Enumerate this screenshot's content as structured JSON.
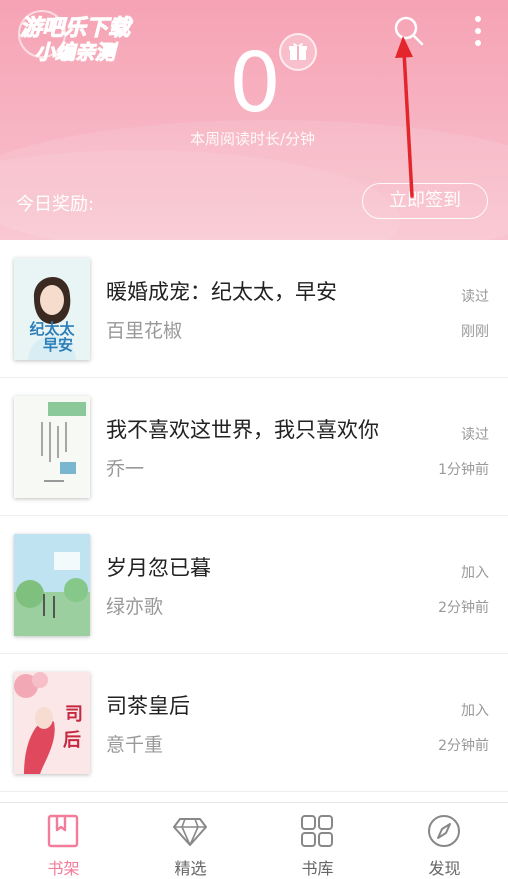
{
  "header": {
    "watermark_line1": "游吧乐下载",
    "watermark_line2": "小编亲测",
    "weekly_minutes": "0",
    "weekly_label": "本周阅读时长/分钟",
    "reward_label": "今日奖励:",
    "signin_label": "立即签到",
    "search_icon": "search-icon",
    "more_icon": "more-vertical-icon",
    "gift_icon": "gift-icon"
  },
  "books": [
    {
      "title": "暖婚成宠：纪太太，早安",
      "author": "百里花椒",
      "status": "读过",
      "time": "刚刚"
    },
    {
      "title": "我不喜欢这世界，我只喜欢你",
      "author": "乔一",
      "status": "读过",
      "time": "1分钟前"
    },
    {
      "title": "岁月忽已暮",
      "author": "绿亦歌",
      "status": "加入",
      "time": "2分钟前"
    },
    {
      "title": "司茶皇后",
      "author": "意千重",
      "status": "加入",
      "time": "2分钟前"
    }
  ],
  "tabs": [
    {
      "label": "书架",
      "icon": "bookshelf-icon",
      "active": true
    },
    {
      "label": "精选",
      "icon": "diamond-icon",
      "active": false
    },
    {
      "label": "书库",
      "icon": "grid-icon",
      "active": false
    },
    {
      "label": "发现",
      "icon": "compass-icon",
      "active": false
    }
  ],
  "colors": {
    "accent": "#f27c9a",
    "header_pink": "#f7b1c0",
    "annotation_arrow": "#e2262b"
  }
}
